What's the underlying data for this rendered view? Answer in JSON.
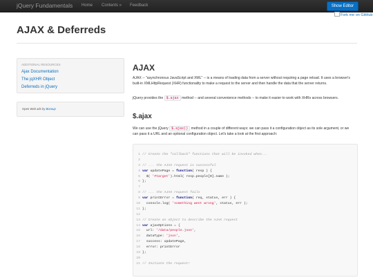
{
  "navbar": {
    "brand": "jQuery Fundamentals",
    "links": [
      "Home",
      "Contents »",
      "Feedback"
    ],
    "show_editor": "Show Editor",
    "fork_text": "Fork me on GitHub"
  },
  "page": {
    "title": "AJAX & Deferreds"
  },
  "sidebar": {
    "heading": "Additional Resources",
    "links": [
      "Ajax Documentation",
      "The jqXHR Object",
      "Deferreds in jQuery"
    ],
    "ads_prefix": "Open Web ads by ",
    "ads_link": "Bocoup"
  },
  "main": {
    "heading": "AJAX",
    "intro": "AJAX -- \"asynchronous JavaScript and XML\" -- is a means of loading data from a server without requiring a page reload. It uses a browser's built-in XMLHttpRequest (XHR) functionality to make a request to the server and then handle the data that the server returns.",
    "provides_before": "jQuery provides the ",
    "provides_code": "$.ajax",
    "provides_after": " method -- and several convenience methods -- to make it easier to work with XHRs across browsers.",
    "subheading": "$.ajax",
    "use_before": "We can use the jQuery ",
    "use_code": "$.ajax()",
    "use_after": " method in a couple of different ways: we can pass it a configuration object as its sole argument, or we can pass it a URL and an optional configuration object. Let's take a look at the first approach:"
  },
  "code": {
    "lines": [
      {
        "n": "1",
        "parts": [
          {
            "t": "// Create the \"callback\" functions that will be invoked when...",
            "c": "comment"
          }
        ]
      },
      {
        "n": "2",
        "parts": []
      },
      {
        "n": "3",
        "parts": [
          {
            "t": "// ... the AJAX request is successful",
            "c": "comment"
          }
        ]
      },
      {
        "n": "4",
        "parts": [
          {
            "t": "var",
            "c": "keyword"
          },
          {
            "t": " updatePage = "
          },
          {
            "t": "function",
            "c": "keyword"
          },
          {
            "t": "( resp ) {"
          }
        ]
      },
      {
        "n": "5",
        "parts": [
          {
            "t": "  $( "
          },
          {
            "t": "'#target'",
            "c": "string"
          },
          {
            "t": ").html( resp.people[0].name );"
          }
        ]
      },
      {
        "n": "6",
        "parts": [
          {
            "t": "};"
          }
        ]
      },
      {
        "n": "7",
        "parts": []
      },
      {
        "n": "8",
        "parts": [
          {
            "t": "// ... the AJAX request fails",
            "c": "comment"
          }
        ]
      },
      {
        "n": "9",
        "parts": [
          {
            "t": "var",
            "c": "keyword"
          },
          {
            "t": " printError = "
          },
          {
            "t": "function",
            "c": "keyword"
          },
          {
            "t": "( req, status, err ) {"
          }
        ]
      },
      {
        "n": "10",
        "parts": [
          {
            "t": "  console.log( "
          },
          {
            "t": "'something went wrong'",
            "c": "string"
          },
          {
            "t": ", status, err );"
          }
        ]
      },
      {
        "n": "11",
        "parts": [
          {
            "t": "};"
          }
        ]
      },
      {
        "n": "12",
        "parts": []
      },
      {
        "n": "13",
        "parts": [
          {
            "t": "// Create an object to describe the AJAX request",
            "c": "comment"
          }
        ]
      },
      {
        "n": "14",
        "parts": [
          {
            "t": "var",
            "c": "keyword"
          },
          {
            "t": " ajaxOptions = {"
          }
        ]
      },
      {
        "n": "15",
        "parts": [
          {
            "t": "  url: "
          },
          {
            "t": "'/data/people.json'",
            "c": "string"
          },
          {
            "t": ","
          }
        ]
      },
      {
        "n": "16",
        "parts": [
          {
            "t": "  dataType: "
          },
          {
            "t": "'json'",
            "c": "string"
          },
          {
            "t": ","
          }
        ]
      },
      {
        "n": "17",
        "parts": [
          {
            "t": "  success: updatePage,"
          }
        ]
      },
      {
        "n": "18",
        "parts": [
          {
            "t": "  error: printError"
          }
        ]
      },
      {
        "n": "19",
        "parts": [
          {
            "t": "};"
          }
        ]
      },
      {
        "n": "20",
        "parts": []
      },
      {
        "n": "21",
        "parts": [
          {
            "t": "// Initiate the request!",
            "c": "comment"
          }
        ]
      }
    ]
  },
  "colors": {
    "navbar": "#222222",
    "primary_button": "#0a6fc2",
    "link": "#0b6dbb",
    "code_string": "#dd1144",
    "code_keyword": "#000088"
  }
}
